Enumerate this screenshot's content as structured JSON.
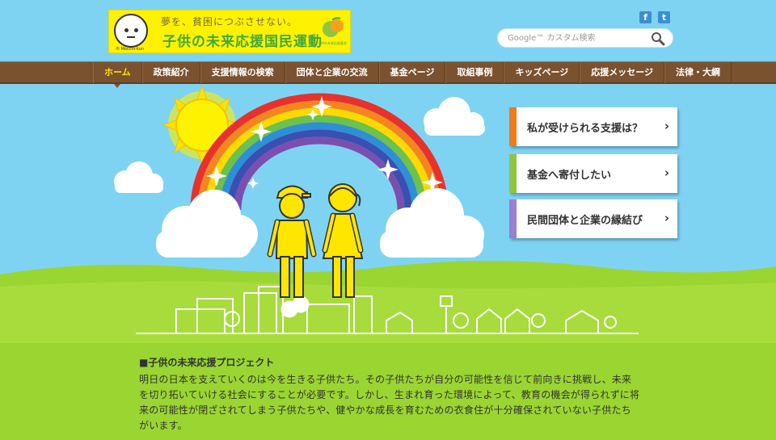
{
  "logo": {
    "tagline": "夢を、貧困につぶさせない。",
    "title": "子供の未来応援国民運動",
    "face_caption": "® Mocchi-kun",
    "mark_caption": "子供の未来応援基金"
  },
  "social": {
    "facebook": "f",
    "twitter": "t"
  },
  "search": {
    "placeholder": "Google™ カスタム検索"
  },
  "nav": {
    "items": [
      {
        "label": "ホーム",
        "active": true
      },
      {
        "label": "政策紹介"
      },
      {
        "label": "支援情報の検索"
      },
      {
        "label": "団体と企業の交流"
      },
      {
        "label": "基金ページ"
      },
      {
        "label": "取組事例"
      },
      {
        "label": "キッズページ"
      },
      {
        "label": "応援メッセージ"
      },
      {
        "label": "法律・大綱"
      }
    ]
  },
  "cta": [
    {
      "label": "私が受けられる支援は？",
      "color": "#f07a1a",
      "chevron": "›"
    },
    {
      "label": "基金へ寄付したい",
      "color": "#8cc63f",
      "chevron": "›"
    },
    {
      "label": "民間団体と企業の縁結び",
      "color": "#9b7fd0",
      "chevron": "›"
    }
  ],
  "content": {
    "heading": "■子供の未来応援プロジェクト",
    "body": "明日の日本を支えていくのは今を生きる子供たち。その子供たちが自分の可能性を信じて前向きに挑戦し、未来を切り拓いていける社会にすることが必要です。しかし、生まれ育った環境によって、教育の機会が得られずに将来の可能性が閉ざされてしまう子供たちや、健やかな成長を育むための衣食住が十分確保されていない子供たちがいます。"
  },
  "colors": {
    "sky": "#7fd3f2",
    "nav_bg": "#7a5230",
    "nav_active": "#ffe600",
    "grass": "#9ad532",
    "logo_bg": "#fff200",
    "logo_green": "#41a83a"
  }
}
